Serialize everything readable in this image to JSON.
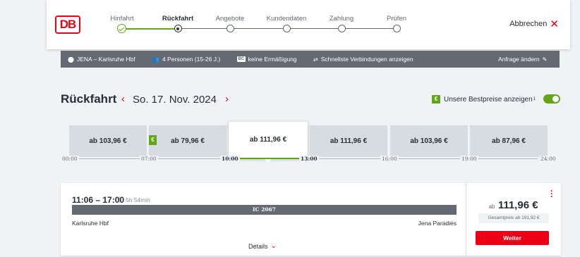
{
  "header": {
    "logo": "DB",
    "steps": [
      {
        "label": "Hinfahrt",
        "state": "done"
      },
      {
        "label": "Rückfahrt",
        "state": "current"
      },
      {
        "label": "Angebote",
        "state": "todo"
      },
      {
        "label": "Kundendaten",
        "state": "todo"
      },
      {
        "label": "Zahlung",
        "state": "todo"
      },
      {
        "label": "Prüfen",
        "state": "todo"
      }
    ],
    "cancel_label": "Abbrechen"
  },
  "infobar": {
    "route": "JENA – Karlsruhe Hbf",
    "persons": "4 Personen (15-26 J.)",
    "discount_badge": "BC",
    "discount": "keine Ermäßigung",
    "mode": "Schnellste Verbindungen anzeigen",
    "change": "Anfrage ändern"
  },
  "titlebar": {
    "title": "Rückfahrt",
    "date": "So. 17. Nov. 2024",
    "bestprice_label": "Unsere Bestpreise anzeigen",
    "bestprice_sup": "1",
    "bestprice_on": true
  },
  "slots": [
    {
      "price": "ab 103,96 €"
    },
    {
      "price": "ab 79,96 €",
      "best": true
    },
    {
      "price": "ab 111,96 €",
      "active": true
    },
    {
      "price": "ab 111,96 €"
    },
    {
      "price": "ab 103,96 €"
    },
    {
      "price": "ab 87,96 €"
    }
  ],
  "timeline": [
    "00:00",
    "07:00",
    "10:00",
    "13:00",
    "16:00",
    "19:00",
    "24:00"
  ],
  "connection": {
    "times": "11:06 – 17:00",
    "separator": "|",
    "duration": "5h 54min",
    "train": "IC 2067",
    "from": "Karlsruhe Hbf",
    "to": "Jena Paradies",
    "details": "Details",
    "price_prefix": "ab",
    "price": "111,96 €",
    "total": "Gesamtpreis ab 191,92 €",
    "cta": "Weiter"
  },
  "colors": {
    "brand": "#ec0016",
    "success": "#63a615",
    "bar": "#646973"
  }
}
